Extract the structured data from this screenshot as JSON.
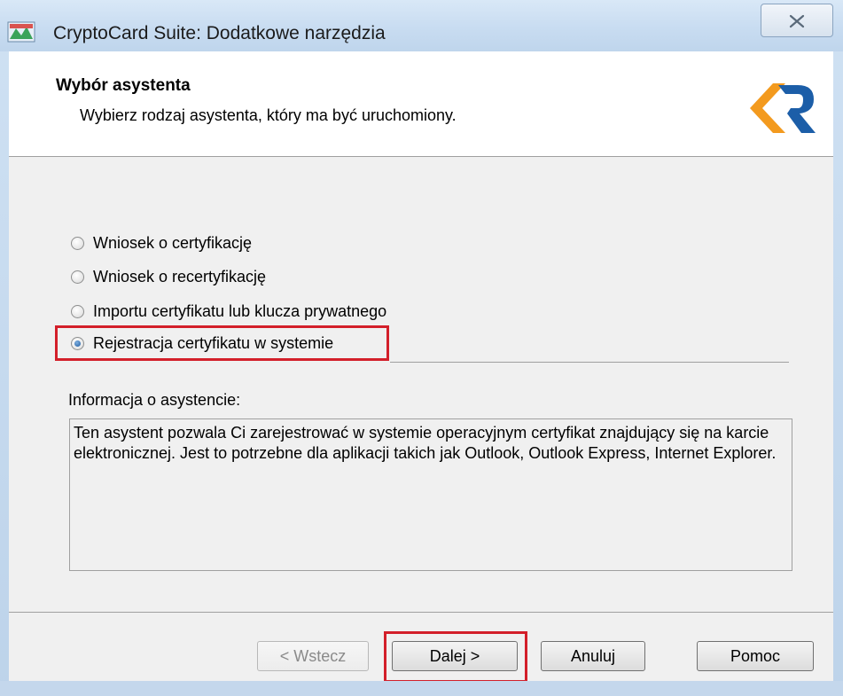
{
  "window": {
    "title": "CryptoCard Suite: Dodatkowe narzędzia",
    "close_icon": "close-icon"
  },
  "header": {
    "title": "Wybór asystenta",
    "subtitle": "Wybierz rodzaj asystenta, który ma być uruchomiony.",
    "logo": "kr-logo"
  },
  "options": [
    {
      "label": "Wniosek o certyfikację",
      "checked": false
    },
    {
      "label": "Wniosek o recertyfikację",
      "checked": false
    },
    {
      "label": "Importu certyfikatu lub klucza prywatnego",
      "checked": false
    },
    {
      "label": "Rejestracja certyfikatu w systemie",
      "checked": true
    }
  ],
  "info": {
    "label": "Informacja o asystencie:",
    "text": "Ten asystent pozwala Ci zarejestrować w systemie operacyjnym certyfikat znajdujący się na karcie elektronicznej. Jest to potrzebne dla aplikacji takich jak Outlook, Outlook Express, Internet Explorer."
  },
  "buttons": {
    "back": "< Wstecz",
    "next": "Dalej >",
    "cancel": "Anuluj",
    "help": "Pomoc"
  },
  "colors": {
    "highlight": "#d31f2a",
    "logo_orange": "#f39a1e",
    "logo_blue": "#1c5ea8"
  }
}
